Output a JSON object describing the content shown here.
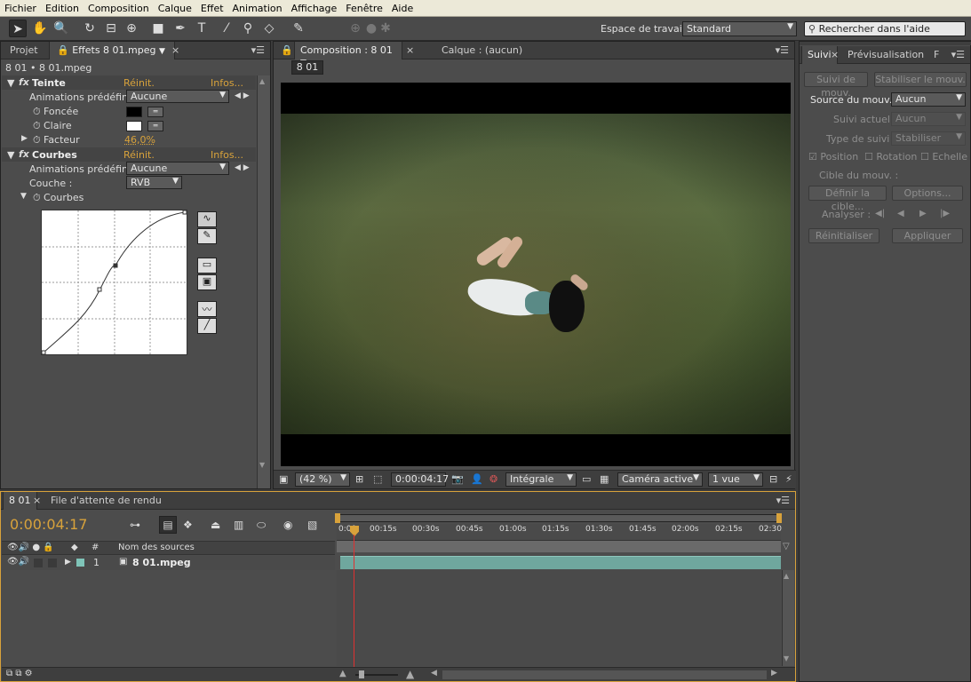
{
  "menu": [
    "Fichier",
    "Edition",
    "Composition",
    "Calque",
    "Effet",
    "Animation",
    "Affichage",
    "Fenêtre",
    "Aide"
  ],
  "toolbar": {
    "workspace_label": "Espace de travail :",
    "workspace_value": "Standard",
    "search_placeholder": "Rechercher dans l'aide"
  },
  "effects_panel": {
    "tab_project": "Projet",
    "tab_effects": "Effets 8 01.mpeg",
    "breadcrumb": "8 01 • 8 01.mpeg",
    "tint": {
      "name": "Teinte",
      "reset": "Réinit.",
      "info": "Infos...",
      "presets_label": "Animations prédéfinies",
      "presets_value": "Aucune",
      "dark_label": "Foncée",
      "light_label": "Claire",
      "factor_label": "Facteur",
      "factor_value": "46,0%",
      "dark_color": "#000000",
      "light_color": "#ffffff"
    },
    "curves": {
      "name": "Courbes",
      "reset": "Réinit.",
      "info": "Infos...",
      "presets_label": "Animations prédéfinies",
      "presets_value": "Aucune",
      "channel_label": "Couche :",
      "channel_value": "RVB",
      "curves_label": "Courbes"
    }
  },
  "composition_panel": {
    "tab_comp": "Composition : 8 01",
    "tab_layer": "Calque : (aucun)",
    "comp_button": "8 01",
    "zoom": "(42 %)",
    "timecode": "0:00:04:17",
    "resolution": "Intégrale",
    "camera": "Caméra active",
    "views": "1 vue"
  },
  "tracker_panel": {
    "tab_tracker": "Suivi",
    "tab_preview": "Prévisualisation",
    "tab_other": "F",
    "btn_track_motion": "Suivi de mouv.",
    "btn_stabilize": "Stabiliser le mouv.",
    "source_label": "Source du mouv. :",
    "source_value": "Aucun",
    "current_label": "Suivi actuel :",
    "current_value": "Aucun",
    "type_label": "Type de suivi :",
    "type_value": "Stabiliser",
    "position": "Position",
    "rotation": "Rotation",
    "scale": "Echelle",
    "target_label": "Cible du mouv. :",
    "btn_define_target": "Définir la cible...",
    "btn_options": "Options...",
    "analyze_label": "Analyser :",
    "btn_reset": "Réinitialiser",
    "btn_apply": "Appliquer"
  },
  "timeline": {
    "tab_comp": "8 01",
    "tab_render": "File d'attente de rendu",
    "timecode": "0:00:04:17",
    "col_number": "#",
    "col_source": "Nom des sources",
    "ruler": [
      "0:00",
      "00:15s",
      "00:30s",
      "00:45s",
      "01:00s",
      "01:15s",
      "01:30s",
      "01:45s",
      "02:00s",
      "02:15s",
      "02:30"
    ],
    "layer_number": "1",
    "layer_name": "8 01.mpeg",
    "layer_color": "#7fc4b8"
  },
  "colors": {
    "accent_orange": "#d8a23b",
    "playhead": "#e03030",
    "layer_bar": "#6fa79e"
  }
}
